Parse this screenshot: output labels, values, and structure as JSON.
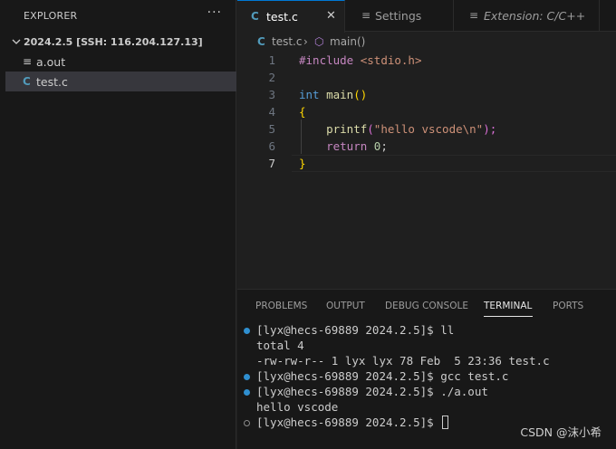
{
  "sidebar": {
    "title": "EXPLORER",
    "more": "···",
    "folder": "2024.2.5 [SSH: 116.204.127.13]",
    "files": [
      {
        "icon": "≡",
        "name": "a.out"
      },
      {
        "icon": "C",
        "name": "test.c"
      }
    ]
  },
  "tabs": [
    {
      "icon": "C",
      "label": "test.c",
      "close": "✕"
    },
    {
      "icon": "≡",
      "label": "Settings"
    },
    {
      "icon": "≡",
      "label": "Extension: C/C++"
    }
  ],
  "breadcrumb": {
    "file_icon": "C",
    "file": "test.c",
    "sep": "›",
    "symbol_icon": "⬡",
    "symbol": "main()"
  },
  "editor": {
    "lines": [
      {
        "num": "1"
      },
      {
        "num": "2"
      },
      {
        "num": "3"
      },
      {
        "num": "4"
      },
      {
        "num": "5"
      },
      {
        "num": "6"
      },
      {
        "num": "7"
      }
    ],
    "code": {
      "l1_a": "#include",
      "l1_b": "<stdio.h>",
      "l3_a": "int",
      "l3_b": "main",
      "l3_c": "()",
      "l4": "{",
      "l5_a": "printf",
      "l5_b": "(",
      "l5_c": "\"hello vscode\\n\"",
      "l5_d": ");",
      "l6_a": "return",
      "l6_b": "0",
      "l6_c": ";",
      "l7": "}"
    }
  },
  "panel": {
    "tabs": [
      "PROBLEMS",
      "OUTPUT",
      "DEBUG CONSOLE",
      "TERMINAL",
      "PORTS"
    ],
    "active_tab": "TERMINAL",
    "terminal": [
      "[lyx@hecs-69889 2024.2.5]$ ll",
      "total 4",
      "-rw-rw-r-- 1 lyx lyx 78 Feb  5 23:36 test.c",
      "[lyx@hecs-69889 2024.2.5]$ gcc test.c",
      "[lyx@hecs-69889 2024.2.5]$ ./a.out",
      "hello vscode",
      "[lyx@hecs-69889 2024.2.5]$ "
    ]
  },
  "watermark": "CSDN @沫小希",
  "colors": {
    "accent": "#0078d4",
    "c_icon": "#519aba",
    "keyword": "#569cd6",
    "control": "#c586c0",
    "function": "#dcdcaa",
    "string": "#ce9178",
    "number": "#b5cea8",
    "bracket": "#ffd700"
  }
}
